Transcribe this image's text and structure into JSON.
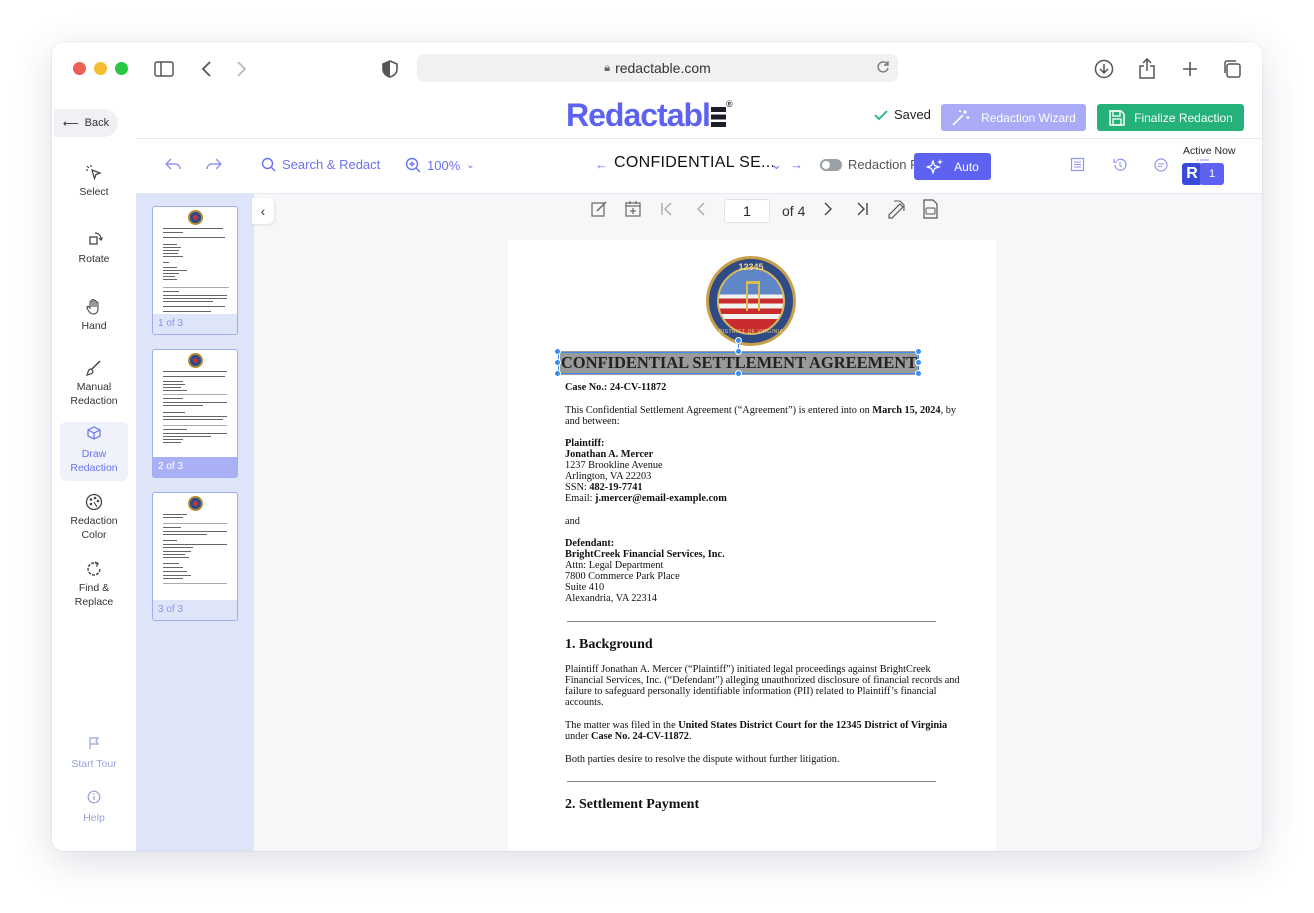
{
  "browser": {
    "url": "redactable.com",
    "dots": [
      "#ee5f57",
      "#f5bd2f",
      "#29c840"
    ]
  },
  "header": {
    "back": "Back",
    "logo_text": "Redactabl",
    "logo_sup": "®",
    "saved": "Saved",
    "wizard": "Redaction Wizard",
    "finalize": "Finalize Redaction"
  },
  "tools": [
    {
      "label": "Select"
    },
    {
      "label": "Rotate"
    },
    {
      "label": "Hand"
    },
    {
      "label": "Manual",
      "label2": "Redaction"
    },
    {
      "label": "Draw",
      "label2": "Redaction"
    },
    {
      "label": "Redaction",
      "label2": "Color"
    },
    {
      "label": "Find &",
      "label2": "Replace"
    },
    {
      "label": "Start Tour"
    },
    {
      "label": "Help"
    }
  ],
  "toolbar": {
    "search": "Search & Redact",
    "zoom": "100%",
    "doc_title": "CONFIDENTIAL SE...",
    "preview": "Redaction Preview",
    "auto": "Auto",
    "active_now": "Active Now",
    "avatar": "R",
    "active_count": "1"
  },
  "thumbnails": [
    {
      "label": "1 of 3"
    },
    {
      "label": "2 of 3"
    },
    {
      "label": "3 of 3"
    }
  ],
  "pager": {
    "current": "1",
    "total": "of 4"
  },
  "document": {
    "seal_number": "12345",
    "seal_text": "DISTRICT OF VIRGINIA",
    "title": "CONFIDENTIAL SETTLEMENT AGREEMENT",
    "case_label": "Case No.: 24-CV-11872",
    "intro_1": "This Confidential Settlement Agreement (“Agreement”) is entered into on",
    "intro_date": "March 15, 2024",
    "intro_2": ", by",
    "intro_3": "and between:",
    "plaintiff_label": "Plaintiff:",
    "plaintiff_name": "Jonathan A. Mercer",
    "plaintiff_addr1": "1237 Brookline Avenue",
    "plaintiff_addr2": "Arlington, VA 22203",
    "ssn_label": "SSN: ",
    "ssn": "482-19-7741",
    "email_label": "Email: ",
    "email": "j.mercer@email-example.com",
    "and": "and",
    "defendant_label": "Defendant:",
    "defendant_name": "BrightCreek Financial Services, Inc.",
    "def_addr1": "Attn: Legal Department",
    "def_addr2": "7800 Commerce Park Place",
    "def_addr3": "Suite 410",
    "def_addr4": "Alexandria, VA 22314",
    "section1": "1. Background",
    "bg_1": "Plaintiff Jonathan A. Mercer (“Plaintiff”) initiated legal proceedings against BrightCreek",
    "bg_2": "Financial Services, Inc. (“Defendant”) alleging unauthorized disclosure of financial records and",
    "bg_3": "failure to safeguard personally identifiable information (PII) related to Plaintiff’s financial",
    "bg_4": "accounts.",
    "filed_1": "The matter was filed in the ",
    "filed_court": "United States District Court for the 12345 District of Virginia",
    "filed_2": "under ",
    "filed_case": "Case No. 24-CV-11872",
    "filed_end": ".",
    "resolve": "Both parties desire to resolve the dispute without further litigation.",
    "section2": "2. Settlement Payment"
  }
}
